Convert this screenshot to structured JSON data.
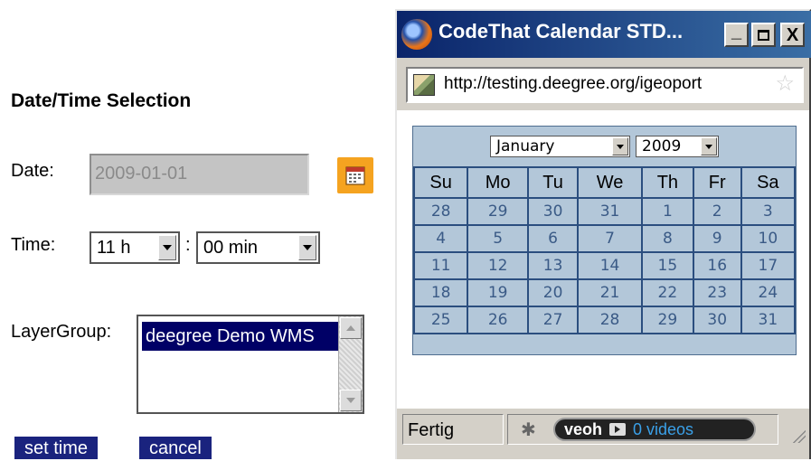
{
  "form": {
    "heading": "Date/Time Selection",
    "date_label": "Date:",
    "date_value": "2009-01-01",
    "time_label": "Time:",
    "hour_value": "11 h",
    "colon": ":",
    "minute_value": "00 min",
    "layergroup_label": "LayerGroup:",
    "layergroup_items": [
      "deegree Demo WMS"
    ],
    "set_time_button": "set time",
    "cancel_button": "cancel",
    "calendar_icon": "calendar-icon"
  },
  "popup": {
    "title": "CodeThat Calendar STD...",
    "url": "http://testing.deegree.org/igeoport",
    "controls": {
      "minimize": "_",
      "maximize": "□",
      "close": "X"
    },
    "calendar": {
      "month": "January",
      "year": "2009",
      "weekdays": [
        "Su",
        "Mo",
        "Tu",
        "We",
        "Th",
        "Fr",
        "Sa"
      ],
      "weeks": [
        [
          "28",
          "29",
          "30",
          "31",
          "1",
          "2",
          "3"
        ],
        [
          "4",
          "5",
          "6",
          "7",
          "8",
          "9",
          "10"
        ],
        [
          "11",
          "12",
          "13",
          "14",
          "15",
          "16",
          "17"
        ],
        [
          "18",
          "19",
          "20",
          "21",
          "22",
          "23",
          "24"
        ],
        [
          "25",
          "26",
          "27",
          "28",
          "29",
          "30",
          "31"
        ]
      ]
    },
    "status": {
      "text": "Fertig",
      "veoh_logo": "veoh",
      "veoh_videos": "0 videos"
    },
    "colors": {
      "title_start": "#0a246a",
      "title_end": "#3a6ea5",
      "calendar_bg": "#b3c7d9",
      "calendar_border": "#2b4e7f",
      "button_bg": "#1a237e",
      "icon_bg": "#f5a320"
    }
  }
}
